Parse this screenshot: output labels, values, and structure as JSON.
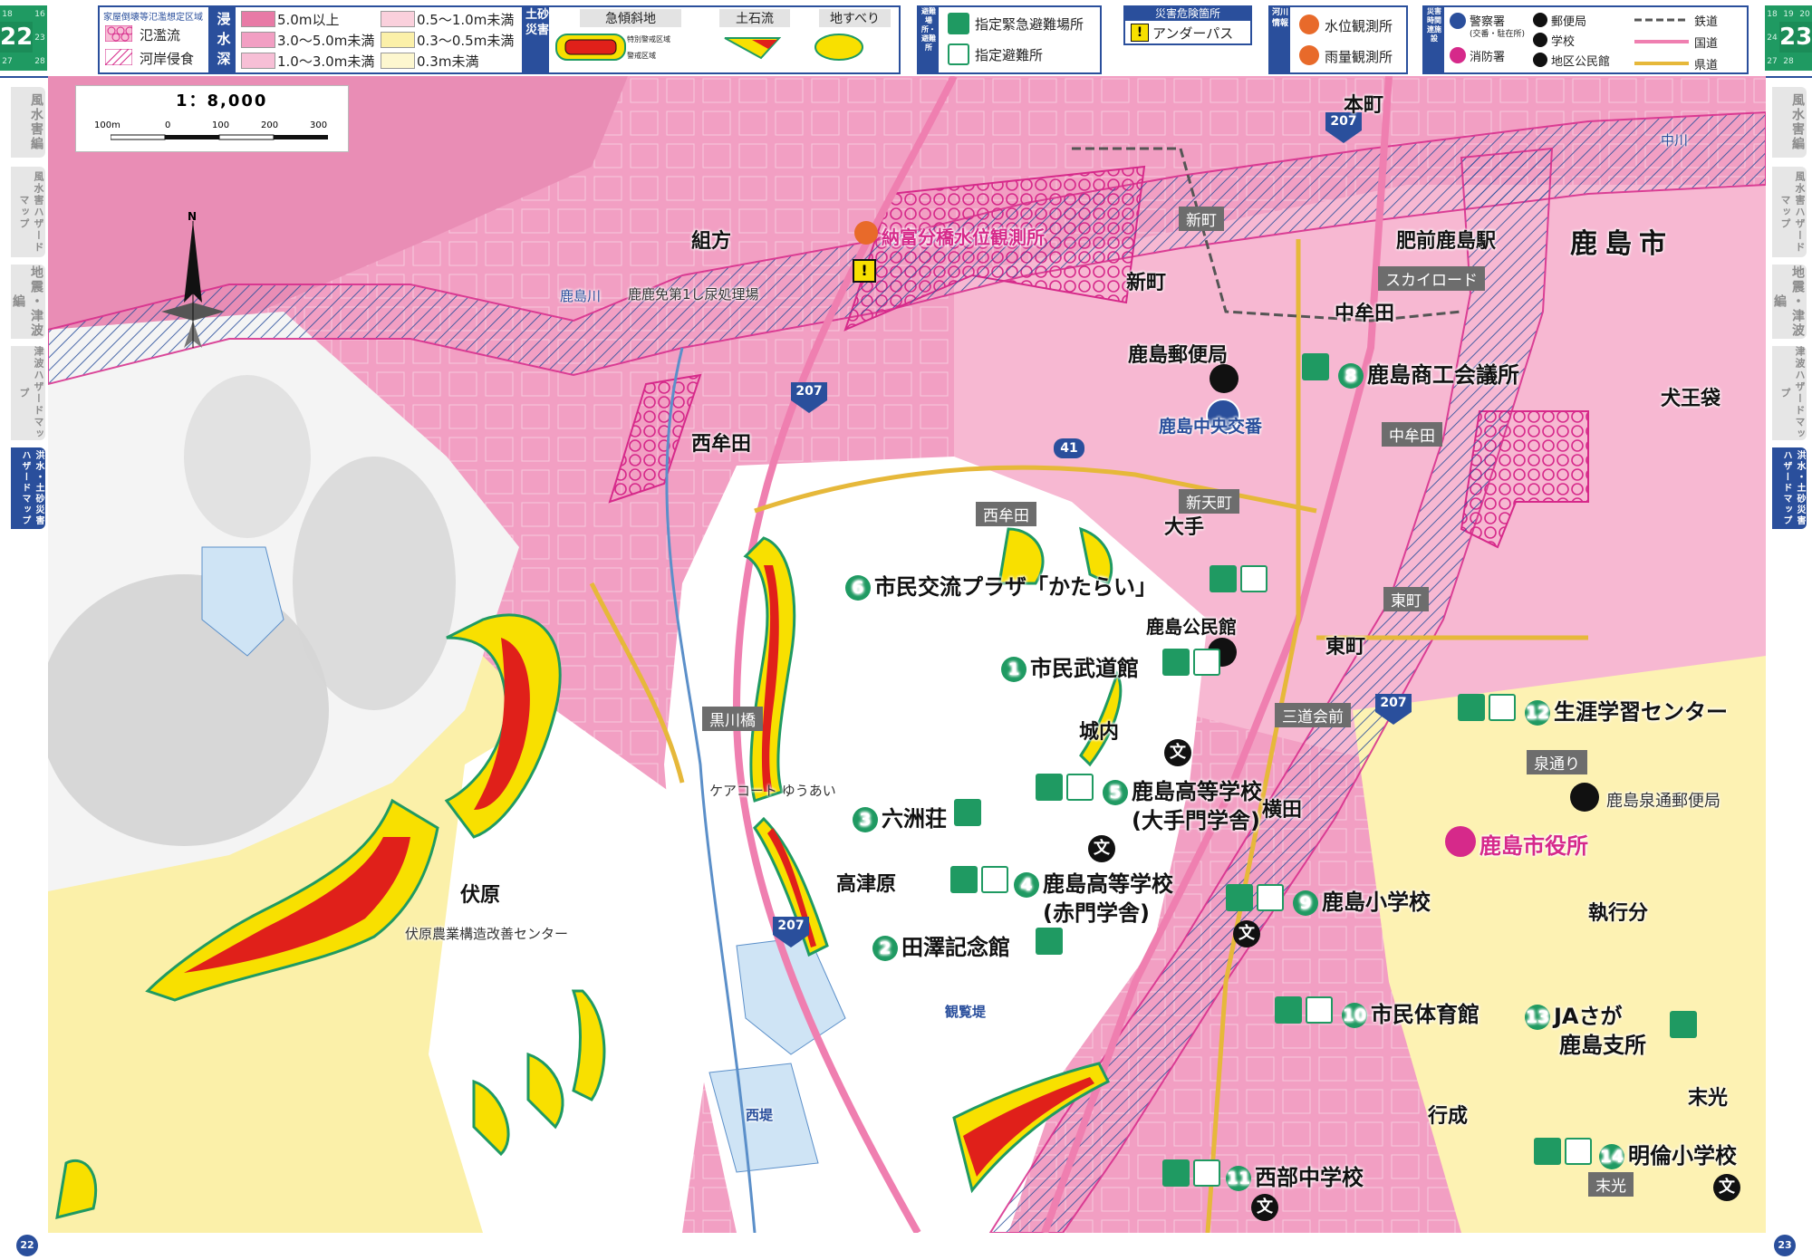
{
  "pages": {
    "left": {
      "number": "22",
      "cells": [
        "18",
        "16",
        "23",
        "27",
        "28"
      ],
      "footer": "22"
    },
    "right": {
      "number": "23",
      "cells": [
        "18",
        "19",
        "20",
        "24",
        "27",
        "28"
      ],
      "footer": "23"
    }
  },
  "legend": {
    "kaoku_title": "家屋倒壊等氾濫想定区域",
    "hanran": "氾濫流",
    "kagan": "河岸侵食",
    "depth_title": "浸水深",
    "depth": [
      {
        "label": "5.0m以上",
        "color": "#e87aa6"
      },
      {
        "label": "3.0〜5.0m未満",
        "color": "#f29fc3"
      },
      {
        "label": "1.0〜3.0m未満",
        "color": "#f7bfd6"
      },
      {
        "label": "0.5〜1.0m未満",
        "color": "#fad0dc"
      },
      {
        "label": "0.3〜0.5m未満",
        "color": "#fbf0a9"
      },
      {
        "label": "0.3m未満",
        "color": "#fdf7cf"
      }
    ],
    "dosha_title": "土砂災害",
    "dosha": [
      "急傾斜地",
      "土石流",
      "地すべり"
    ],
    "dosha_sub": [
      "特別警戒区域",
      "警戒区域"
    ],
    "hinan_title": "避難場所・避難所",
    "hinan": [
      "指定緊急避難場所",
      "指定避難所"
    ],
    "kiken_title": "災害危険箇所",
    "kiken": "アンダーパス",
    "kasen_title": "河川情報",
    "kasen": [
      "水位観測所",
      "雨量観測所"
    ],
    "shisetsu_title": "災害時関連施設",
    "shisetsu": [
      "警察署",
      "(交番・駐在所)",
      "消防署",
      "郵便局",
      "学校",
      "地区公民館",
      "鉄道",
      "国道",
      "県道"
    ]
  },
  "sidebar": {
    "left": [
      "風水害編",
      "風水害ハザードマップ",
      "地震・津波編",
      "津波ハザードマップ",
      "洪水・土砂災害ハザードマップ"
    ],
    "right": [
      "風水害編",
      "風水害ハザードマップ",
      "地震・津波編",
      "津波ハザードマップ",
      "洪水・土砂災害ハザードマップ"
    ]
  },
  "map": {
    "scale": "1：8,000",
    "scale_ticks": [
      "100m",
      "0",
      "100",
      "200",
      "300"
    ],
    "north": "N",
    "city": "鹿島市",
    "places": [
      "本町",
      "組方",
      "新町",
      "中牟田",
      "犬王袋",
      "西牟田",
      "大手",
      "東町",
      "城内",
      "伏原",
      "高津原",
      "横田",
      "執行分",
      "行成",
      "末光"
    ],
    "small_labels": [
      "鹿島川",
      "中川",
      "鹿鹿免第1し尿処理場",
      "肥前鹿島駅",
      "伏原農業構造改善センター",
      "ケアコート ゆうあい",
      "観覧堤",
      "西堤"
    ],
    "road_tags": [
      "新町",
      "スカイロード",
      "中牟田",
      "西牟田",
      "新天町",
      "東町",
      "黒川橋",
      "三道会前",
      "泉通り",
      "末光"
    ],
    "route_numbers": [
      "207",
      "207",
      "41",
      "207",
      "207"
    ],
    "station": "鹿島郵便局",
    "police": "鹿島中央交番",
    "post2": "鹿島泉通郵便局",
    "city_hall": "鹿島市役所",
    "observatory": "納富分橋水位観測所",
    "kominkan": "鹿島公民館",
    "shelters": [
      {
        "no": "1",
        "name": "市民武道館"
      },
      {
        "no": "2",
        "name": "田澤記念館"
      },
      {
        "no": "3",
        "name": "六洲荘"
      },
      {
        "no": "4",
        "name": "鹿島高等学校",
        "sub": "(赤門学舎)"
      },
      {
        "no": "5",
        "name": "鹿島高等学校",
        "sub": "(大手門学舎)"
      },
      {
        "no": "6",
        "name": "市民交流プラザ「かたらい」"
      },
      {
        "no": "8",
        "name": "鹿島商工会議所"
      },
      {
        "no": "9",
        "name": "鹿島小学校"
      },
      {
        "no": "10",
        "name": "市民体育館"
      },
      {
        "no": "11",
        "name": "西部中学校"
      },
      {
        "no": "12",
        "name": "生涯学習センター"
      },
      {
        "no": "13",
        "name": "JAさが",
        "sub": "鹿島支所"
      },
      {
        "no": "14",
        "name": "明倫小学校"
      }
    ],
    "school_glyph": "文",
    "underpass_glyph": "!"
  },
  "colors": {
    "accent": "#2a4f9c",
    "shelter": "#1f9a62",
    "flood_deep": "#f29fc3",
    "flood_mid": "#f7bfd6",
    "flood_shallow": "#fdf2b3",
    "river_hatch": "#2a4f9c",
    "red_zone": "#e0201a",
    "yellow_zone": "#f8e000"
  }
}
